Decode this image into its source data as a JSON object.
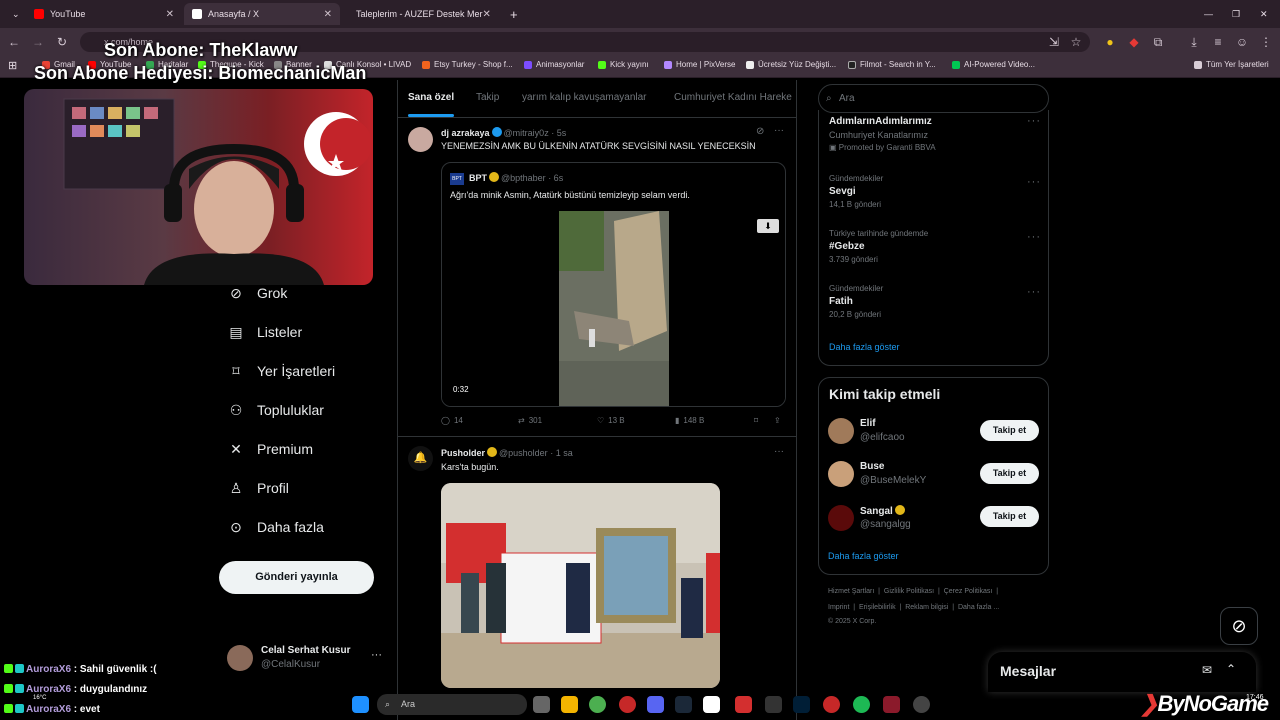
{
  "browser": {
    "tabs": [
      {
        "title": "YouTube",
        "color": "#ff0000"
      },
      {
        "title": "Anasayfa / X",
        "color": "#ffffff"
      },
      {
        "title": "Taleplerim - AUZEF Destek Mer",
        "color": "#c7d93a"
      }
    ],
    "url": "x.com/home",
    "bookmarks": [
      "Gmail",
      "YouTube",
      "Haritalar",
      "Thegune - Kick",
      "Banner",
      "Canlı Konsol • LIVAD",
      "Etsy Turkey - Shop f...",
      "Animasyonlar",
      "Kick yayını",
      "Home | PixVerse",
      "Ücretsiz Yüz Değişti...",
      "Filmot - Search in Y...",
      "AI-Powered Video...",
      "Tüm Yer İşaretleri"
    ]
  },
  "overlay": {
    "line1": "Son Abone: TheKlaww",
    "line2": "Son Abone Hediyesi: BiomechanicMan"
  },
  "nav": {
    "items": [
      "Grok",
      "Listeler",
      "Yer İşaretleri",
      "Topluluklar",
      "Premium",
      "Profil",
      "Daha fazla"
    ],
    "post_button": "Gönderi yayınla",
    "account_name": "Celal Serhat Kusur",
    "account_handle": "@CelalKusur"
  },
  "feed": {
    "tabs": [
      "Sana özel",
      "Takip",
      "yarım kalıp kavuşamayanlar",
      "Cumhuriyet Kadını Hareke"
    ],
    "posts": [
      {
        "name": "dj azrakaya",
        "handle": "@mitraiy0z",
        "time": "· 5s",
        "text": "YENEMEZSİN AMK BU ÜLKENİN ATATÜRK SEVGİSİNİ NASIL YENECEKSİN",
        "quote": {
          "name": "BPT",
          "handle": "@bpthaber",
          "time": "· 6s",
          "text": "Ağrı'da minik Asmin, Atatürk büstünü temizleyip selam verdi.",
          "video_time": "0:32"
        },
        "replies": "14",
        "reposts": "301",
        "likes": "13 B",
        "views": "148 B"
      },
      {
        "name": "Pusholder",
        "handle": "@pusholder",
        "time": "· 1 sa",
        "text": "Kars'ta bugün."
      }
    ]
  },
  "right": {
    "search_placeholder": "Ara",
    "trends": [
      {
        "category": "",
        "name": "AdımlarınAdımlarımız",
        "count": "Cumhuriyet Kanatlarımız",
        "promo": "Promoted by Garanti BBVA"
      },
      {
        "category": "Gündemdekiler",
        "name": "Sevgi",
        "count": "14,1 B gönderi"
      },
      {
        "category": "Türkiye tarihinde gündemde",
        "name": "#Gebze",
        "count": "3.739 gönderi"
      },
      {
        "category": "Gündemdekiler",
        "name": "Fatih",
        "count": "20,2 B gönderi"
      }
    ],
    "show_more": "Daha fazla göster",
    "who_to_follow_title": "Kimi takip etmeli",
    "follow": [
      {
        "name": "Elif",
        "handle": "@elifcaoo"
      },
      {
        "name": "Buse",
        "handle": "@BuseMelekY"
      },
      {
        "name": "Sangal",
        "handle": "@sangalgg"
      }
    ],
    "follow_label": "Takip et",
    "footer1": [
      "Hizmet Şartları",
      "Gizlilik Politikası",
      "Çerez Politikası"
    ],
    "footer2": [
      "Imprint",
      "Erişilebilirlik",
      "Reklam bilgisi",
      "Daha fazla ..."
    ],
    "copyright": "© 2025 X Corp.",
    "messages": "Mesajlar"
  },
  "chat": [
    {
      "user": "AuroraX6",
      "msg": ": Sahil güvenlik :("
    },
    {
      "user": "AuroraX6",
      "msg": ": duygulandınız"
    },
    {
      "user": "AuroraX6",
      "msg": ": evet"
    }
  ],
  "taskbar": {
    "search": "Ara",
    "weather": "16°C",
    "clock": "17:46"
  },
  "watermark": "ByNoGame"
}
